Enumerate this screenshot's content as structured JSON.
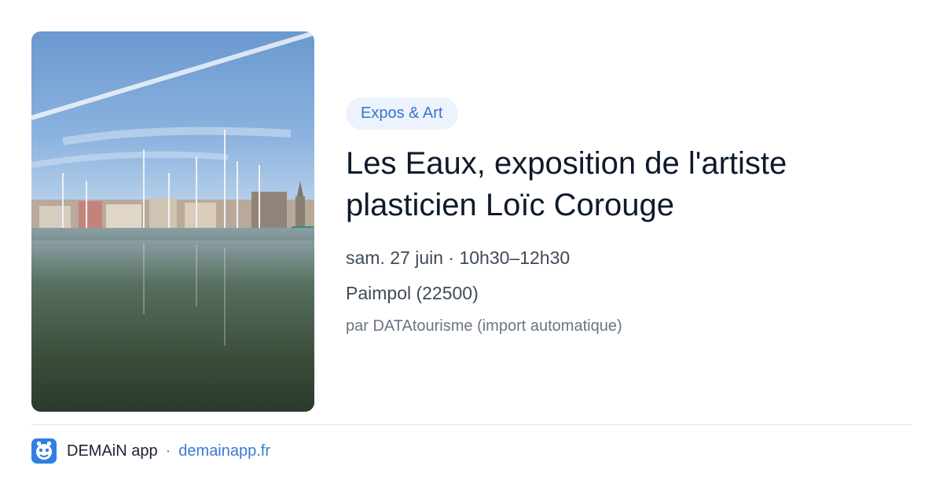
{
  "event": {
    "category": "Expos & Art",
    "title": "Les Eaux, exposition de l'artiste plasticien Loïc Corouge",
    "datetime": "sam. 27 juin · 10h30–12h30",
    "location": "Paimpol (22500)",
    "source": "par DATAtourisme (import automatique)"
  },
  "footer": {
    "app_name": "DEMAiN app",
    "separator": "·",
    "site": "demainapp.fr"
  },
  "icons": {
    "app": "demain-app-icon"
  },
  "colors": {
    "title": "#0e1a2b",
    "category_bg": "#edf3fc",
    "category_text": "#3874cb",
    "link": "#3a7bd0",
    "app_icon": "#2f7fe4"
  }
}
